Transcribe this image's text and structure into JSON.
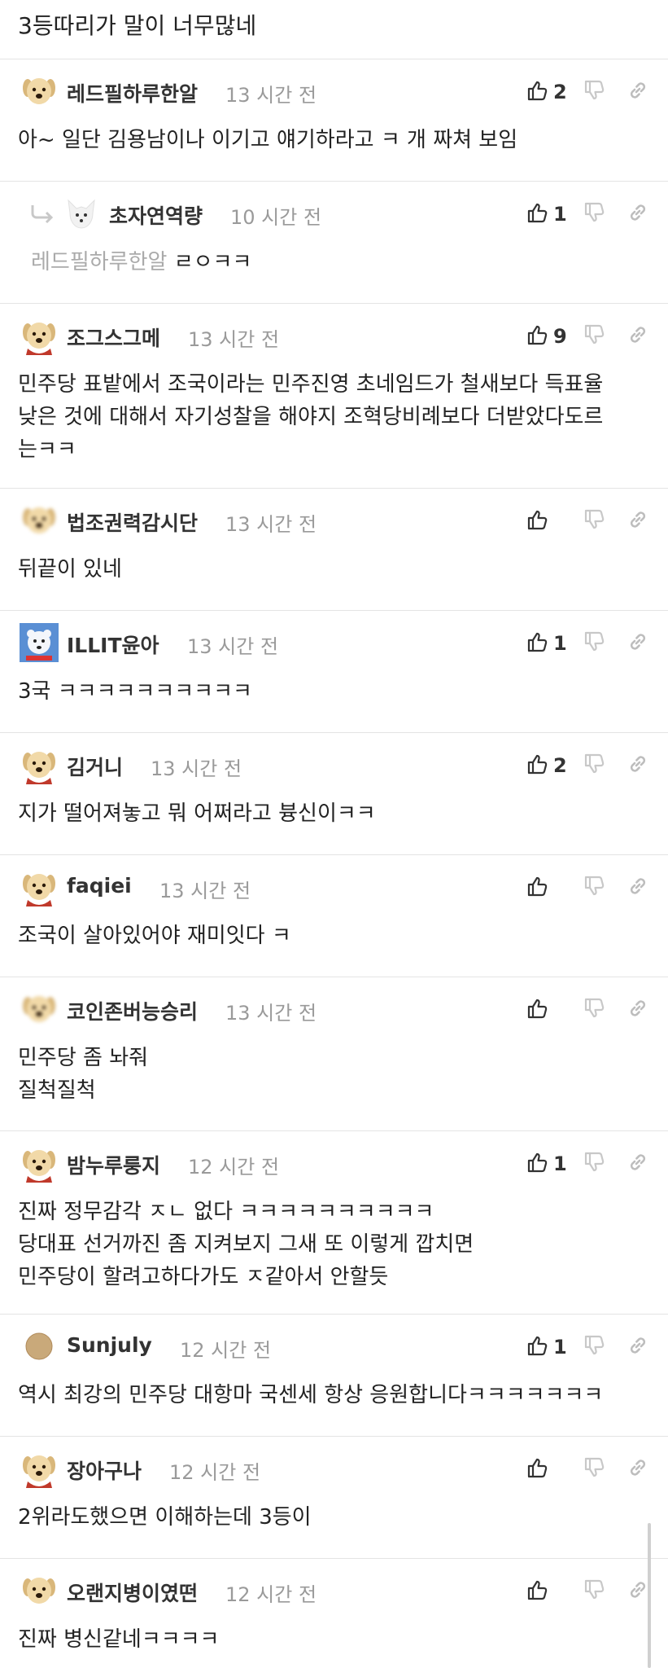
{
  "top_comment_tail": "3등따리가 말이 너무많네",
  "comments": [
    {
      "nick": "레드필하루한알",
      "time": "13 시간 전",
      "likes": "2",
      "lines": [
        "아~ 일단 김용남이나 이기고 얘기하라고 ㅋ 개 짜쳐 보임"
      ],
      "avatar": "puppy"
    },
    {
      "nick": "초자연역량",
      "time": "10 시간 전",
      "likes": "1",
      "reply_to": "레드필하루한알",
      "lines": [
        "ㄹㅇㅋㅋ"
      ],
      "avatar": "fox"
    },
    {
      "nick": "조그스그메",
      "time": "13 시간 전",
      "likes": "9",
      "lines": [
        "민주당 표밭에서 조국이라는 민주진영 초네임드가 철새보다 득표율",
        "낮은 것에 대해서 자기성찰을 해야지 조혁당비례보다 더받았다도르",
        "는ㅋㅋ"
      ],
      "avatar": "puppy-red"
    },
    {
      "nick": "법조권력감시단",
      "time": "13 시간 전",
      "likes": "",
      "lines": [
        "뒤끝이 있네"
      ],
      "avatar": "puppy-blur"
    },
    {
      "nick": "ILLIT윤아",
      "time": "13 시간 전",
      "likes": "1",
      "lines": [
        "3국 ㅋㅋㅋㅋㅋㅋㅋㅋㅋㅋ"
      ],
      "avatar": "bear"
    },
    {
      "nick": "김거니",
      "time": "13 시간 전",
      "likes": "2",
      "lines": [
        "지가 떨어져놓고 뭐 어쩌라고 븅신이ㅋㅋ"
      ],
      "avatar": "puppy-red"
    },
    {
      "nick": "faqiei",
      "time": "13 시간 전",
      "likes": "",
      "lines": [
        "조국이 살아있어야 재미잇다 ㅋ"
      ],
      "avatar": "puppy-red"
    },
    {
      "nick": "코인존버능승리",
      "time": "13 시간 전",
      "likes": "",
      "lines": [
        "민주당 좀 놔줘",
        "질척질척"
      ],
      "avatar": "puppy-blur"
    },
    {
      "nick": "밤누루룽지",
      "time": "12 시간 전",
      "likes": "1",
      "lines": [
        "진짜 정무감각 ㅈㄴ 없다 ㅋㅋㅋㅋㅋㅋㅋㅋㅋㅋ",
        "당대표 선거까진 좀 지켜보지 그새 또 이렇게 깝치면",
        "민주당이 할려고하다가도 ㅈ같아서 안할듯"
      ],
      "avatar": "puppy-red"
    },
    {
      "nick": "Sunjuly",
      "time": "12 시간 전",
      "likes": "1",
      "lines": [
        "역시 최강의 민주당 대항마 국센세 항상 응원합니다ㅋㅋㅋㅋㅋㅋㅋ"
      ],
      "avatar": "circle"
    },
    {
      "nick": "장아구나",
      "time": "12 시간 전",
      "likes": "",
      "lines": [
        "2위라도했으면 이해하는데 3등이"
      ],
      "avatar": "puppy-red"
    },
    {
      "nick": "오랜지병이였떤",
      "time": "12 시간 전",
      "likes": "",
      "lines": [
        "진짜 병신같네ㅋㅋㅋㅋ"
      ],
      "avatar": "puppy"
    }
  ]
}
